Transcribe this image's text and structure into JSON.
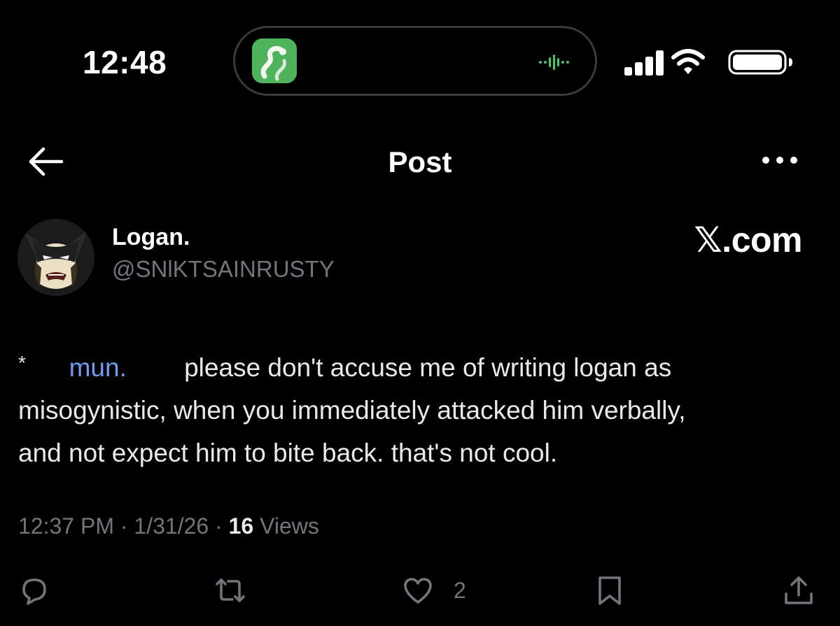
{
  "status_bar": {
    "time": "12:48",
    "island_app_icon": "snake-app-icon",
    "audio_indicator_icon": "audio-wave-icon",
    "signal_icon": "cellular-signal-icon",
    "wifi_icon": "wifi-icon",
    "battery_icon": "battery-icon"
  },
  "nav": {
    "back_icon": "back-arrow-icon",
    "title": "Post",
    "more_icon": "more-dots-icon"
  },
  "author": {
    "name": "Logan.",
    "handle": "@SNlKTSAINRUSTY",
    "avatar_icon": "wolverine-avatar"
  },
  "watermark": "𝕏.com",
  "post": {
    "asterisk": "*",
    "mention": "mun.",
    "text_part1": "please don't accuse me of writing logan as",
    "text_part2": "misogynistic, when you immediately attacked him verbally,",
    "text_part3": "and not expect him to bite back. that's not cool."
  },
  "meta": {
    "time": "12:37 PM",
    "separator": " · ",
    "date": "1/31/26",
    "views_count": "16",
    "views_label": "Views"
  },
  "actions": {
    "reply_icon": "reply-icon",
    "repost_icon": "repost-icon",
    "like_icon": "heart-icon",
    "like_count": "2",
    "bookmark_icon": "bookmark-icon",
    "share_icon": "share-icon"
  },
  "colors": {
    "background": "#000000",
    "text_primary": "#e7e9ea",
    "text_secondary": "#71767b",
    "mention": "#6d9eeb",
    "island_icon_green": "#4fb35c"
  }
}
